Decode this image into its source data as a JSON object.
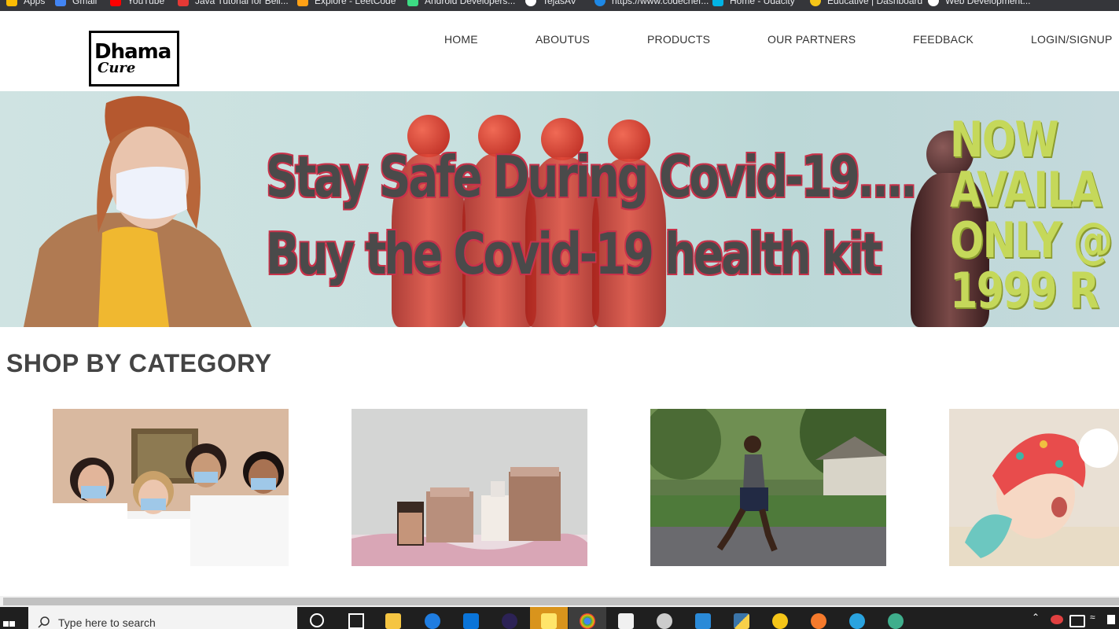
{
  "browser": {
    "bookmarks": [
      {
        "label": "Apps",
        "icon": "apps-grid-icon",
        "color": "#fbbc04"
      },
      {
        "label": "Gmail",
        "icon": "gmail-icon",
        "color": "#4285f4"
      },
      {
        "label": "YouTube",
        "icon": "youtube-icon",
        "color": "#ff0000"
      },
      {
        "label": "Java Tutorial for Beli...",
        "icon": "bookmark-icon",
        "color": "#e53935"
      },
      {
        "label": "Explore - LeetCode",
        "icon": "leetcode-icon",
        "color": "#ffa116"
      },
      {
        "label": "Android Developers...",
        "icon": "android-icon",
        "color": "#3ddc84"
      },
      {
        "label": "TejasAV",
        "icon": "github-icon",
        "color": "#ffffff"
      },
      {
        "label": "https://www.codechef...",
        "icon": "codechef-icon",
        "color": "#1e88e5"
      },
      {
        "label": "Home - Udacity",
        "icon": "udacity-icon",
        "color": "#02b3e4"
      },
      {
        "label": "Educative | Dashboard",
        "icon": "educative-icon",
        "color": "#f5c518"
      },
      {
        "label": "Web Development...",
        "icon": "web-dev-icon",
        "color": "#ffffff"
      }
    ]
  },
  "site": {
    "logo": {
      "line1": "Dhama",
      "line2": "Cure"
    },
    "nav": [
      "HOME",
      "ABOUTUS",
      "PRODUCTS",
      "OUR PARTNERS",
      "FEEDBACK",
      "LOGIN/SIGNUP"
    ],
    "hero": {
      "line1": "Stay Safe During Covid-19....",
      "line2": "Buy  the Covid-19 health kit",
      "offer": [
        "NOW",
        "AVAILA",
        "ONLY @",
        "1999 R"
      ]
    },
    "section_title": "SHOP BY CATEGORY",
    "categories": [
      {
        "icon": "masks-group-photo"
      },
      {
        "icon": "skincare-products-photo"
      },
      {
        "icon": "runner-fitness-photo"
      },
      {
        "icon": "baby-care-photo"
      }
    ]
  },
  "taskbar": {
    "search_placeholder": "Type here to search",
    "apps": [
      "cortana-icon",
      "task-view-icon",
      "file-explorer-icon",
      "edge-icon",
      "mail-icon",
      "eclipse-icon",
      "sticky-notes-icon",
      "chrome-icon",
      "store-icon",
      "settings-icon",
      "vscode-icon",
      "python-icon",
      "flutter-icon",
      "brave-icon",
      "telegram-icon",
      "chatgpt-icon"
    ]
  },
  "colors": {
    "accent_red": "#c8324a",
    "offer_yellow": "#c5d85a",
    "hero_bg": "#c8e0df"
  }
}
